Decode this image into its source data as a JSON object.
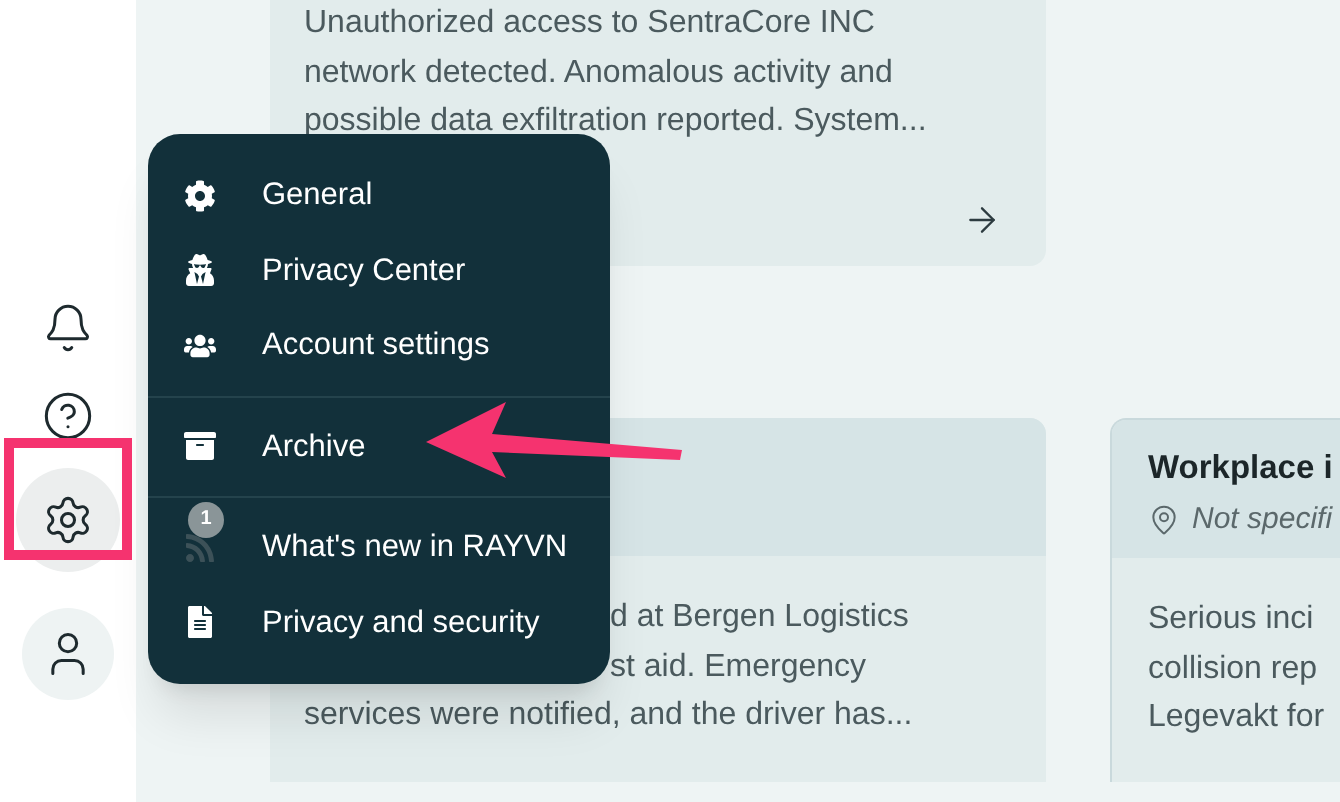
{
  "sidebar": {
    "items": [
      {
        "selected": false
      },
      {
        "selected": false
      },
      {
        "selected": true
      }
    ]
  },
  "cards": [
    {
      "lines": [
        "Unauthorized access to SentraCore INC",
        "network detected. Anomalous activity and",
        "possible data exfiltration reported. System..."
      ]
    },
    {
      "lines": [
        "d at Bergen Logistics",
        "st aid. Emergency",
        "services were notified, and the driver has..."
      ]
    },
    {
      "title": "Workplace i",
      "location": "Not specifi",
      "lines": [
        "Serious inci",
        "collision rep",
        "Legevakt for"
      ]
    }
  ],
  "menu": {
    "sections": [
      [
        {
          "label": "General"
        },
        {
          "label": "Privacy Center"
        },
        {
          "label": "Account settings"
        }
      ],
      [
        {
          "label": "Archive"
        }
      ],
      [
        {
          "label": "What's new in RAYVN",
          "badge": "1"
        },
        {
          "label": "Privacy and security"
        }
      ]
    ]
  }
}
